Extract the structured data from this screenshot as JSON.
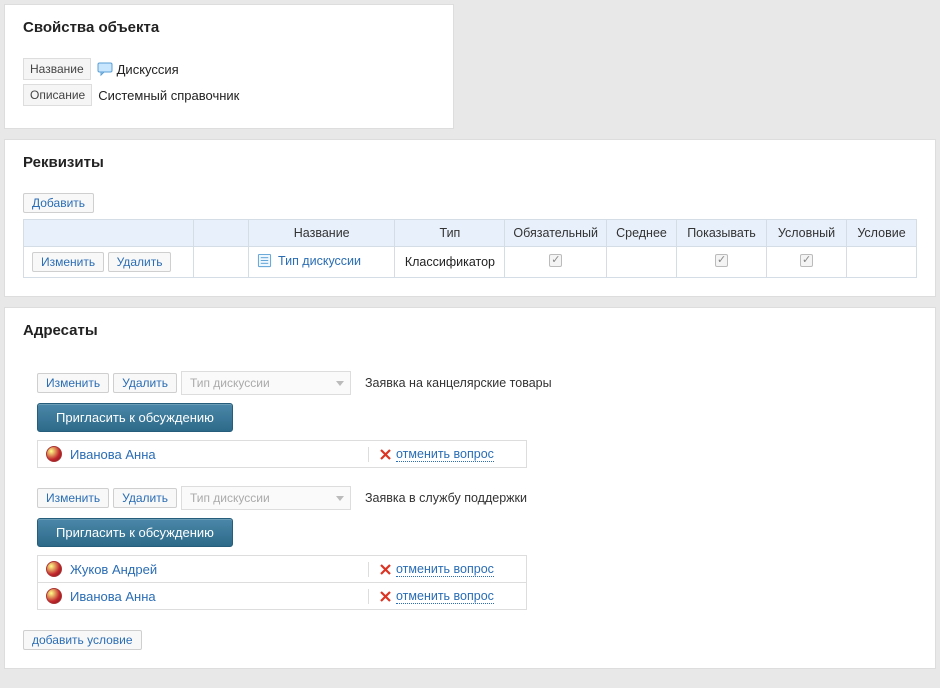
{
  "props": {
    "title": "Свойства объекта",
    "name_label": "Название",
    "name_value": "Дискуссия",
    "desc_label": "Описание",
    "desc_value": "Системный справочник"
  },
  "req": {
    "title": "Реквизиты",
    "add_btn": "Добавить",
    "edit_btn": "Изменить",
    "delete_btn": "Удалить",
    "headers": {
      "name": "Название",
      "type": "Тип",
      "required": "Обязательный",
      "avg": "Среднее",
      "show": "Показывать",
      "cond": "Условный",
      "cond_expr": "Условие"
    },
    "row": {
      "name": "Тип дискуссии",
      "type": "Классификатор"
    }
  },
  "rec": {
    "title": "Адресаты",
    "edit_btn": "Изменить",
    "delete_btn": "Удалить",
    "select_placeholder": "Тип дискуссии",
    "invite_btn": "Пригласить к обсуждению",
    "cancel_label": "отменить вопрос",
    "add_condition": "добавить условие",
    "blocks": [
      {
        "note": "Заявка на канцелярские товары",
        "participants": [
          {
            "name": "Иванова Анна"
          }
        ]
      },
      {
        "note": "Заявка в службу поддержки",
        "participants": [
          {
            "name": "Жуков Андрей"
          },
          {
            "name": "Иванова Анна"
          }
        ]
      }
    ]
  }
}
